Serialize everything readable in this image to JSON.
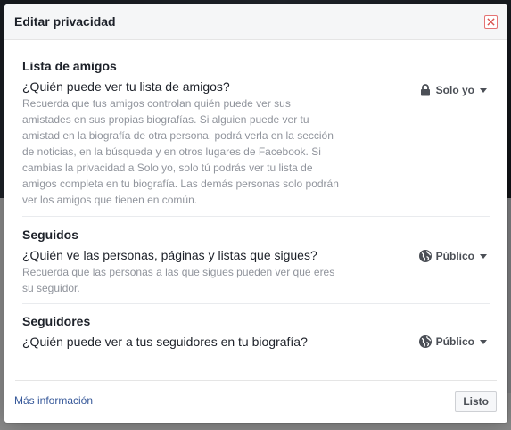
{
  "dialog": {
    "title": "Editar privacidad",
    "sections": [
      {
        "title": "Lista de amigos",
        "question": "¿Quién puede ver tu lista de amigos?",
        "description": "Recuerda que tus amigos controlan quién puede ver sus amistades en sus propias biografías. Si alguien puede ver tu amistad en la biografía de otra persona, podrá verla en la sección de noticias, en la búsqueda y en otros lugares de Facebook. Si cambias la privacidad a Solo yo, solo tú podrás ver tu lista de amigos completa en tu biografía. Las demás personas solo podrán ver los amigos que tienen en común.",
        "audience": "Solo yo",
        "audience_icon": "lock-icon"
      },
      {
        "title": "Seguidos",
        "question": "¿Quién ve las personas, páginas y listas que sigues?",
        "description": "Recuerda que las personas a las que sigues pueden ver que eres su seguidor.",
        "audience": "Público",
        "audience_icon": "globe-icon"
      },
      {
        "title": "Seguidores",
        "question": "¿Quién puede ver a tus seguidores en tu biografía?",
        "description": "",
        "audience": "Público",
        "audience_icon": "globe-icon"
      }
    ],
    "footer": {
      "more_info": "Más información",
      "done": "Listo"
    }
  },
  "colors": {
    "link": "#365899",
    "close_border": "#e57373",
    "text": "#1d2129",
    "muted": "#90949c"
  }
}
